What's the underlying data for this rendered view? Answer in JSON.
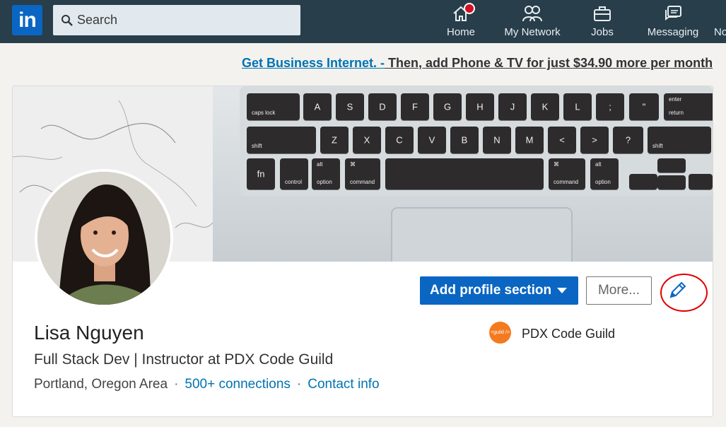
{
  "nav": {
    "logo": "in",
    "search_placeholder": "Search",
    "items": [
      {
        "label": "Home",
        "icon": "home-icon"
      },
      {
        "label": "My Network",
        "icon": "network-icon"
      },
      {
        "label": "Jobs",
        "icon": "briefcase-icon"
      },
      {
        "label": "Messaging",
        "icon": "messaging-icon"
      },
      {
        "label": "No",
        "icon": "notifications-icon"
      }
    ]
  },
  "ad": {
    "link": "Get Business Internet. -",
    "text": " Then, add Phone & TV for just $34.90 more per month"
  },
  "profile": {
    "name": "Lisa Nguyen",
    "headline": "Full Stack Dev | Instructor at PDX Code Guild",
    "location": "Portland, Oregon Area",
    "separator": "·",
    "connections": "500+ connections",
    "contact": "Contact info",
    "add_section": "Add profile section",
    "more": "More...",
    "company": "PDX Code Guild",
    "company_logo_text": "<guild />"
  },
  "keyboard": {
    "row1": [
      {
        "main": "caps lock",
        "sub": ""
      },
      {
        "main": "A"
      },
      {
        "main": "S"
      },
      {
        "main": "D"
      },
      {
        "main": "F"
      },
      {
        "main": "G"
      },
      {
        "main": "H"
      },
      {
        "main": "J"
      },
      {
        "main": "K"
      },
      {
        "main": "L"
      },
      {
        "main": ";"
      },
      {
        "main": "\""
      },
      {
        "main": "return",
        "sub": "enter"
      }
    ],
    "row2": [
      {
        "main": "shift"
      },
      {
        "main": "Z"
      },
      {
        "main": "X"
      },
      {
        "main": "C"
      },
      {
        "main": "V"
      },
      {
        "main": "B"
      },
      {
        "main": "N"
      },
      {
        "main": "M"
      },
      {
        "main": "<"
      },
      {
        "main": ">"
      },
      {
        "main": "?"
      },
      {
        "main": "shift"
      }
    ],
    "row3": [
      {
        "main": "fn"
      },
      {
        "main": "control"
      },
      {
        "main": "option",
        "sub": "alt"
      },
      {
        "main": "command",
        "sub": "⌘"
      },
      {
        "main": ""
      },
      {
        "main": "command",
        "sub": "⌘"
      },
      {
        "main": "option",
        "sub": "alt"
      }
    ]
  },
  "colors": {
    "nav_bg": "#283e4a",
    "brand_blue": "#0a66c2",
    "link_blue": "#0073b1",
    "annotation_red": "#e00000"
  }
}
